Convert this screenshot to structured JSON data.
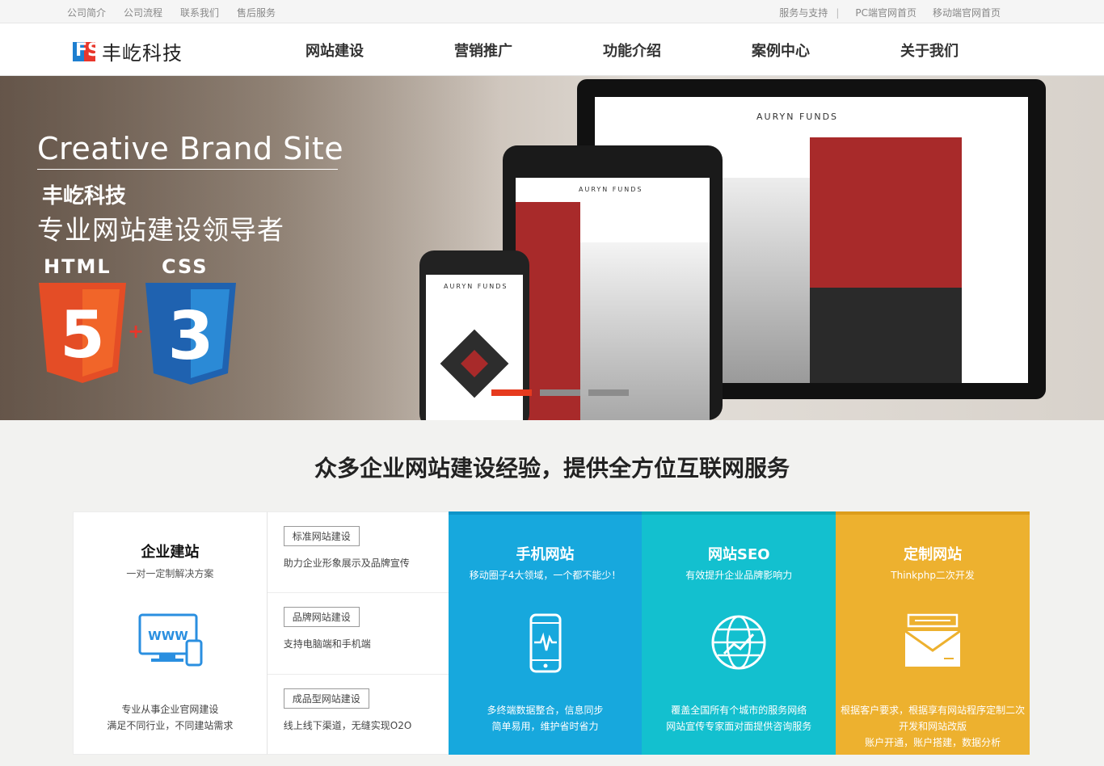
{
  "topbar": {
    "left_links": [
      "公司简介",
      "公司流程",
      "联系我们",
      "售后服务"
    ],
    "support": "服务与支持",
    "separator": "|",
    "pc_home": "PC端官网首页",
    "mobile_home": "移动端官网首页"
  },
  "nav": {
    "logo_mark": "FS",
    "logo_text": "丰屹科技",
    "menu": [
      "网站建设",
      "营销推广",
      "功能介绍",
      "案例中心",
      "关于我们"
    ]
  },
  "banner": {
    "title": "Creative Brand Site",
    "brand": "丰屹科技",
    "subtitle": "专业网站建设领导者",
    "html_label": "HTML",
    "css_label": "CSS",
    "html_num": "5",
    "css_num": "3",
    "plus": "+",
    "screen_logo": "AURYN FUNDS",
    "slides": 3,
    "active_slide": 1,
    "accent": "#e63a1e"
  },
  "section": {
    "title": "众多企业网站建设经验，提供全方位互联网服务"
  },
  "cards": {
    "enterprise": {
      "title": "企业建站",
      "subtitle": "一对一定制解决方案",
      "icon": "www-device-icon",
      "icon_text": "WWW",
      "desc1": "专业从事企业官网建设",
      "desc2": "满足不同行业，不同建站需求"
    },
    "services": [
      {
        "tag": "标准网站建设",
        "text": "助力企业形象展示及品牌宣传"
      },
      {
        "tag": "品牌网站建设",
        "text": "支持电脑端和手机端"
      },
      {
        "tag": "成品型网站建设",
        "text": "线上线下渠道，无缝实现O2O"
      }
    ],
    "mobile": {
      "title": "手机网站",
      "subtitle": "移动圈子4大领域，一个都不能少！",
      "icon": "phone-pulse-icon",
      "desc1": "多终端数据整合，信息同步",
      "desc2": "简单易用，维护省时省力",
      "color": "#17a8dd"
    },
    "seo": {
      "title": "网站SEO",
      "subtitle": "有效提升企业品牌影响力",
      "icon": "globe-icon",
      "desc1": "覆盖全国所有个城市的服务网络",
      "desc2": "网站宣传专家面对面提供咨询服务",
      "color": "#13c0cf"
    },
    "custom": {
      "title": "定制网站",
      "subtitle": "Thinkphp二次开发",
      "icon": "envelope-icon",
      "desc1": "根据客户要求，根据享有网站程序定制二次",
      "desc2": "开发和网站改版",
      "desc3": "账户开通，账户搭建，数据分析",
      "color": "#edb12f"
    }
  }
}
